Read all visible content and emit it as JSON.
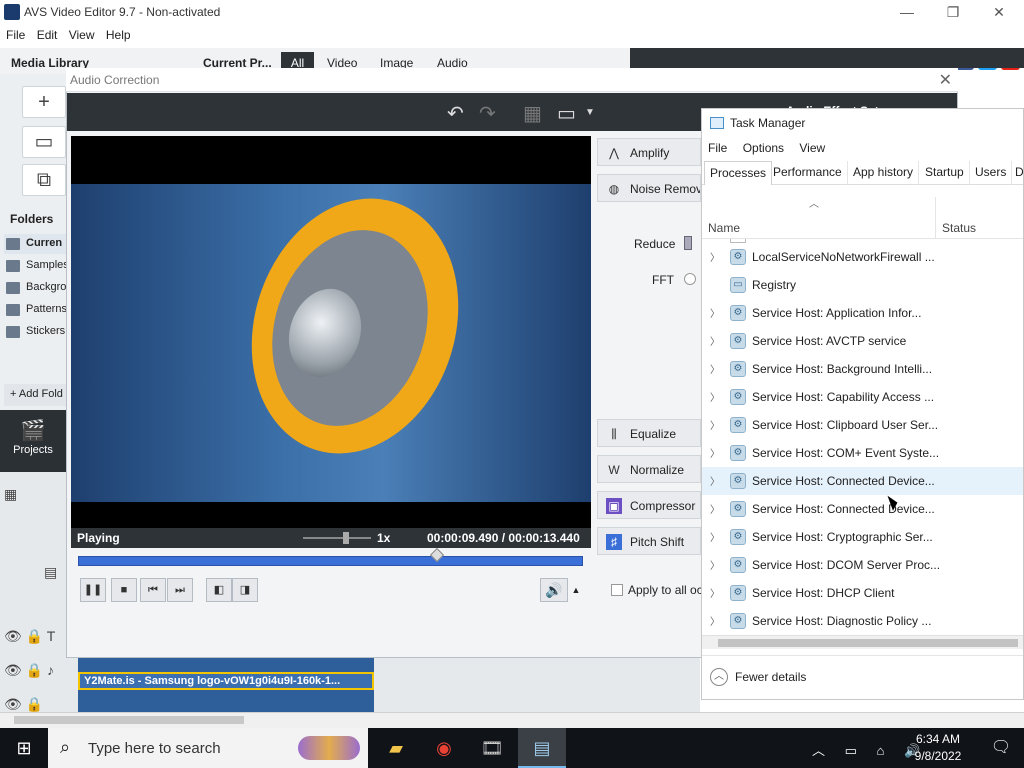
{
  "avs": {
    "title": "AVS Video Editor 9.7 - Non-activated",
    "menu": [
      "File",
      "Edit",
      "View",
      "Help"
    ],
    "social": [
      "f",
      "t",
      "▶"
    ],
    "media_library_title": "Media Library",
    "toolbar": {
      "current_project": "Current Pr...",
      "filter_tabs": [
        "All",
        "Video",
        "Image",
        "Audio"
      ]
    },
    "folders_title": "Folders",
    "folders": [
      "Curren",
      "Samples",
      "Backgro",
      "Patterns",
      "Stickers"
    ],
    "add_folder": "Add Fold",
    "projects_label": "Projects",
    "audio_clip_label": "Y2Mate.is - Samsung logo-vOW1g0i4u9I-160k-1..."
  },
  "audio_correction": {
    "title": "Audio Correction",
    "effects_title": "Audio Effect Set...",
    "player": {
      "state": "Playing",
      "speed": "1x",
      "time": "00:00:09.490  /  00:00:13.440",
      "progress_fraction": 0.71
    },
    "effects_top": [
      "Amplify",
      "Noise Removal"
    ],
    "effects_bottom": [
      "Equalize",
      "Normalize",
      "Compressor",
      "Pitch Shift"
    ],
    "params": {
      "reduce": "Reduce",
      "fft": "FFT"
    },
    "apply_all": "Apply to all occ"
  },
  "task_manager": {
    "title": "Task Manager",
    "menu": [
      "File",
      "Options",
      "View"
    ],
    "tabs": [
      "Processes",
      "Performance",
      "App history",
      "Startup",
      "Users",
      "D"
    ],
    "active_tab": "Processes",
    "columns": {
      "name": "Name",
      "status": "Status"
    },
    "processes": [
      {
        "name": "LocalServiceNoNetworkFirewall ...",
        "expandable": true
      },
      {
        "name": "Registry",
        "expandable": false
      },
      {
        "name": "Service Host: Application Infor...",
        "expandable": true
      },
      {
        "name": "Service Host: AVCTP service",
        "expandable": true
      },
      {
        "name": "Service Host: Background Intelli...",
        "expandable": true
      },
      {
        "name": "Service Host: Capability Access ...",
        "expandable": true
      },
      {
        "name": "Service Host: Clipboard User Ser...",
        "expandable": true
      },
      {
        "name": "Service Host: COM+ Event Syste...",
        "expandable": true
      },
      {
        "name": "Service Host: Connected Device...",
        "expandable": true,
        "highlighted": true
      },
      {
        "name": "Service Host: Connected Device...",
        "expandable": true
      },
      {
        "name": "Service Host: Cryptographic Ser...",
        "expandable": true
      },
      {
        "name": "Service Host: DCOM Server Proc...",
        "expandable": true
      },
      {
        "name": "Service Host: DHCP Client",
        "expandable": true
      },
      {
        "name": "Service Host: Diagnostic Policy ...",
        "expandable": true
      }
    ],
    "fewer_details": "Fewer details"
  },
  "taskbar": {
    "search_placeholder": "Type here to search",
    "clock_time": "6:34 AM",
    "clock_date": "9/8/2022"
  },
  "colors": {
    "accent_blue": "#3a6fd8",
    "toolbar_dark": "#2e3338",
    "clip_border": "#f3c400",
    "taskbar": "#101318"
  }
}
